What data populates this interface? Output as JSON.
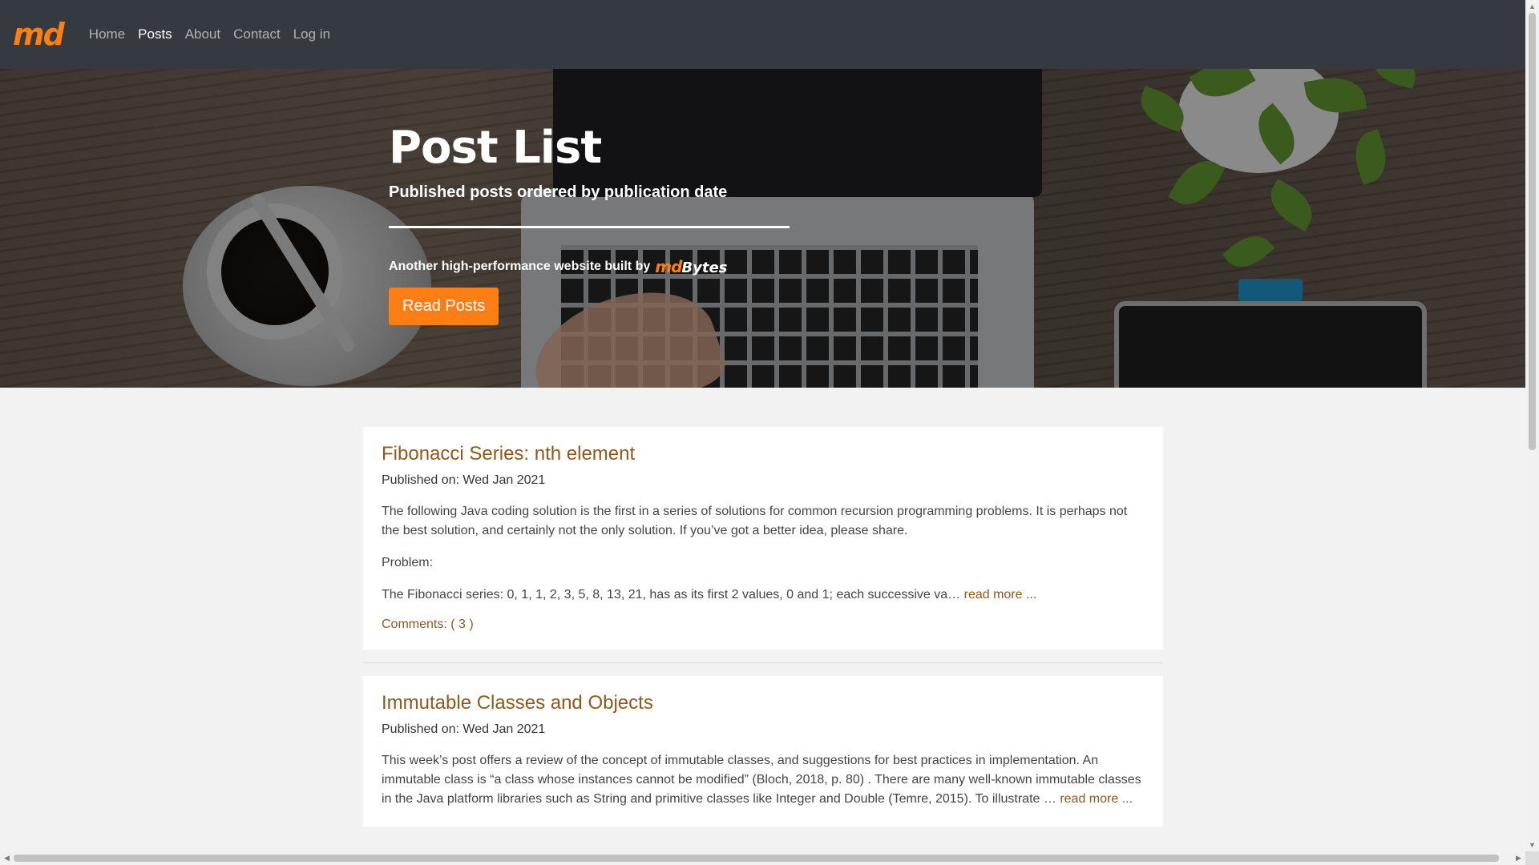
{
  "navbar": {
    "logo": "md",
    "links": [
      {
        "label": "Home"
      },
      {
        "label": "Posts"
      },
      {
        "label": "About"
      },
      {
        "label": "Contact"
      },
      {
        "label": "Log in"
      }
    ],
    "active": "Posts"
  },
  "hero": {
    "title": "Post List",
    "subtitle": "Published posts ordered by publication date",
    "tagline": "Another high-performance website built by",
    "brand_md": "md",
    "brand_word": "Bytes",
    "button_label": "Read Posts"
  },
  "posts": [
    {
      "title": "Fibonacci Series: nth element",
      "published": "Published on: Wed Jan 2021",
      "paragraphs": [
        "The following Java coding solution is the first in a series of solutions for common recursion programming problems. It is perhaps not the best solution, and certainly not the only solution. If you’ve got a better idea, please share.",
        "Problem:",
        "The Fibonacci series: 0, 1, 1, 2, 3, 5, 8, 13, 21, has as its first 2 values, 0 and 1; each successive va…"
      ],
      "read_more": "read more ...",
      "comments": "Comments: ( 3 )"
    },
    {
      "title": "Immutable Classes and Objects",
      "published": "Published on: Wed Jan 2021",
      "paragraphs": [
        "This week’s post offers a review of the concept of immutable classes, and suggestions for best practices in implementation.  An immutable class is “a class whose instances cannot be modified” (Bloch, 2018, p. 80) .  There are many well-known immutable classes in the Java platform libraries such as String and primitive classes like Integer and Double (Temre, 2015). To illustrate …"
      ],
      "read_more": "read more ..."
    }
  ],
  "colors": {
    "accent": "#fd7e14",
    "navbar_bg": "#343a40",
    "link": "#8b5a1e",
    "page_bg": "#f2f2f2"
  }
}
